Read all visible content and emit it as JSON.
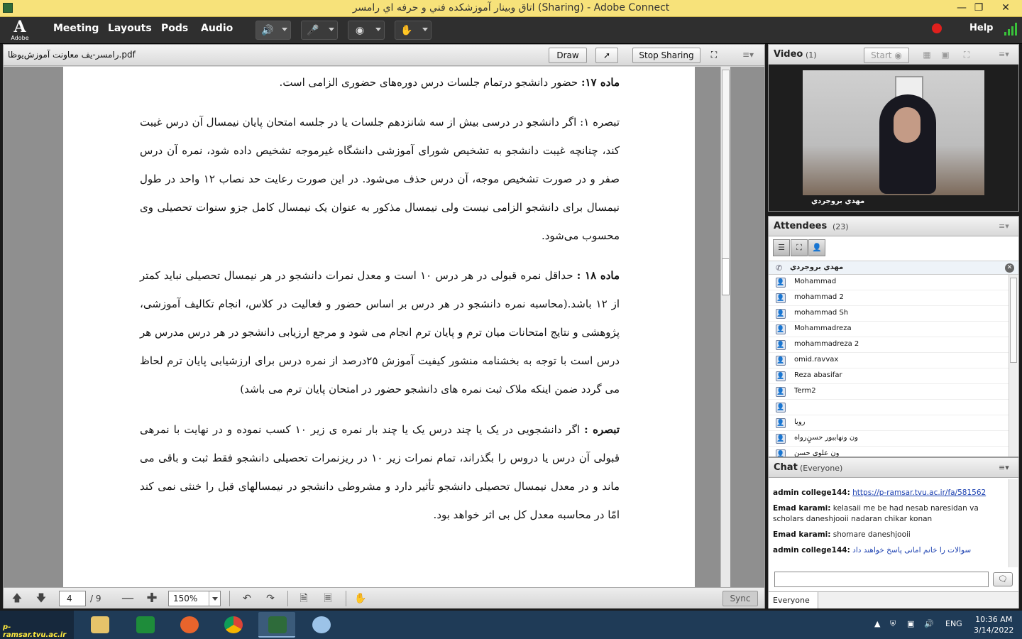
{
  "window": {
    "title": "اتاق وبينار آموزشكده فني و حرفه اي رامسر (Sharing) - Adobe Connect"
  },
  "logo": {
    "text": "Adobe"
  },
  "menu": [
    "Meeting",
    "Layouts",
    "Pods",
    "Audio"
  ],
  "help": "Help",
  "share": {
    "filename": "رامسر-یف معاونت آموزش‌یوظا.pdf",
    "draw_label": "Draw",
    "stop_label": "Stop Sharing",
    "page_current": "4",
    "page_total": "/ 9",
    "zoom": "150%",
    "sync_label": "Sync"
  },
  "document": {
    "paragraphs": [
      {
        "bold": "ماده ۱۷:",
        "text": " حضور دانشجو درتمام جلسات درس دوره‌های حضوری الزامی است."
      },
      {
        "bold": "",
        "text": "تبصره ۱: اگر دانشجو در درسی بیش از سه شانزدهم جلسات یا در جلسه امتحان پایان نیمسال آن درس غیبت کند، چنانچه غیبت دانشجو به تشخیص شورای آموزشی دانشگاه غیرموجه تشخیص داده شود، نمره آن درس صفر و در صورت تشخیص موجه، آن درس حذف می‌شود. در این صورت رعایت حد نصاب ۱۲ واحد در طول نیمسال برای دانشجو الزامی نیست ولی نیمسال مذکور به عنوان یک نیمسال کامل جزو سنوات تحصیلی وی محسوب می‌شود."
      },
      {
        "bold": "ماده ۱۸ :",
        "text": " حداقل نمره قبولی در هر درس ۱۰ است و معدل نمرات دانشجو در هر نیمسال تحصیلی نباید کمتر از ۱۲ باشد.(محاسبه نمره دانشجو در هر درس بر اساس حضور و فعالیت در کلاس، انجام تکالیف آموزشی، پژوهشی و نتایج امتحانات میان ترم و پایان ترم انجام می شود و مرجع ارزیابی دانشجو در هر درس مدرس هر درس است با توجه به بخشنامه منشور کیفیت آموزش ۲۵درصد از نمره درس برای ارزشیابی پایان ترم لحاظ می گردد ضمن اینکه ملاک ثبت نمره های دانشجو حضور در امتحان پایان ترم می باشد)"
      },
      {
        "bold": "تبصره :",
        "text": " اگر دانشجویی در یک یا چند درس یک یا چند بار نمره ی زیر ۱۰ کسب نموده و در نهایت با نمرهی قبولی آن درس یا دروس را بگذراند، تمام نمرات زیر ۱۰ در ریزنمرات تحصیلی دانشجو فقط ثبت و باقی می ماند و در معدل نیمسال تحصیلی دانشجو تأثیر دارد و مشروطی دانشجو در نیمسالهای قبل را خنثی نمی کند امّا در محاسبه معدل کل بی اثر خواهد بود."
      }
    ]
  },
  "video": {
    "title": "Video",
    "count": "(1)",
    "start_label": "Start",
    "participant": "مهدي بروجردي"
  },
  "attendees": {
    "title": "Attendees",
    "count": "(23)",
    "presenter": "مهدي بروجردي",
    "list": [
      "Mohammad",
      "mohammad 2",
      "mohammad Sh",
      "Mohammadreza",
      "mohammadreza 2",
      "omid.ravvax",
      "Reza abasifar",
      "Term2",
      "",
      "رویا",
      "ون ونهاببور حسنٍ‌رواه",
      "ون علوی حسن"
    ]
  },
  "chat": {
    "title": "Chat",
    "scope": "(Everyone)",
    "messages": [
      {
        "sender": "admin college144:",
        "text": "https://p-ramsar.tvu.ac.ir/fa/581562",
        "link": true
      },
      {
        "sender": "Emad karami:",
        "text": "kelasaii me be had nesab naresidan va scholars daneshjooii nadaran chikar konan"
      },
      {
        "sender": "Emad karami:",
        "text": "shomare daneshjooii"
      },
      {
        "sender": "admin college144:",
        "text": "سوالات را خانم امانی پاسخ خواهند داد"
      }
    ],
    "recipient": "Everyone"
  },
  "taskbar": {
    "start_text": "p-ramsar.tvu.ac.ir",
    "lang": "ENG",
    "time": "10:36 AM",
    "date": "3/14/2022"
  }
}
